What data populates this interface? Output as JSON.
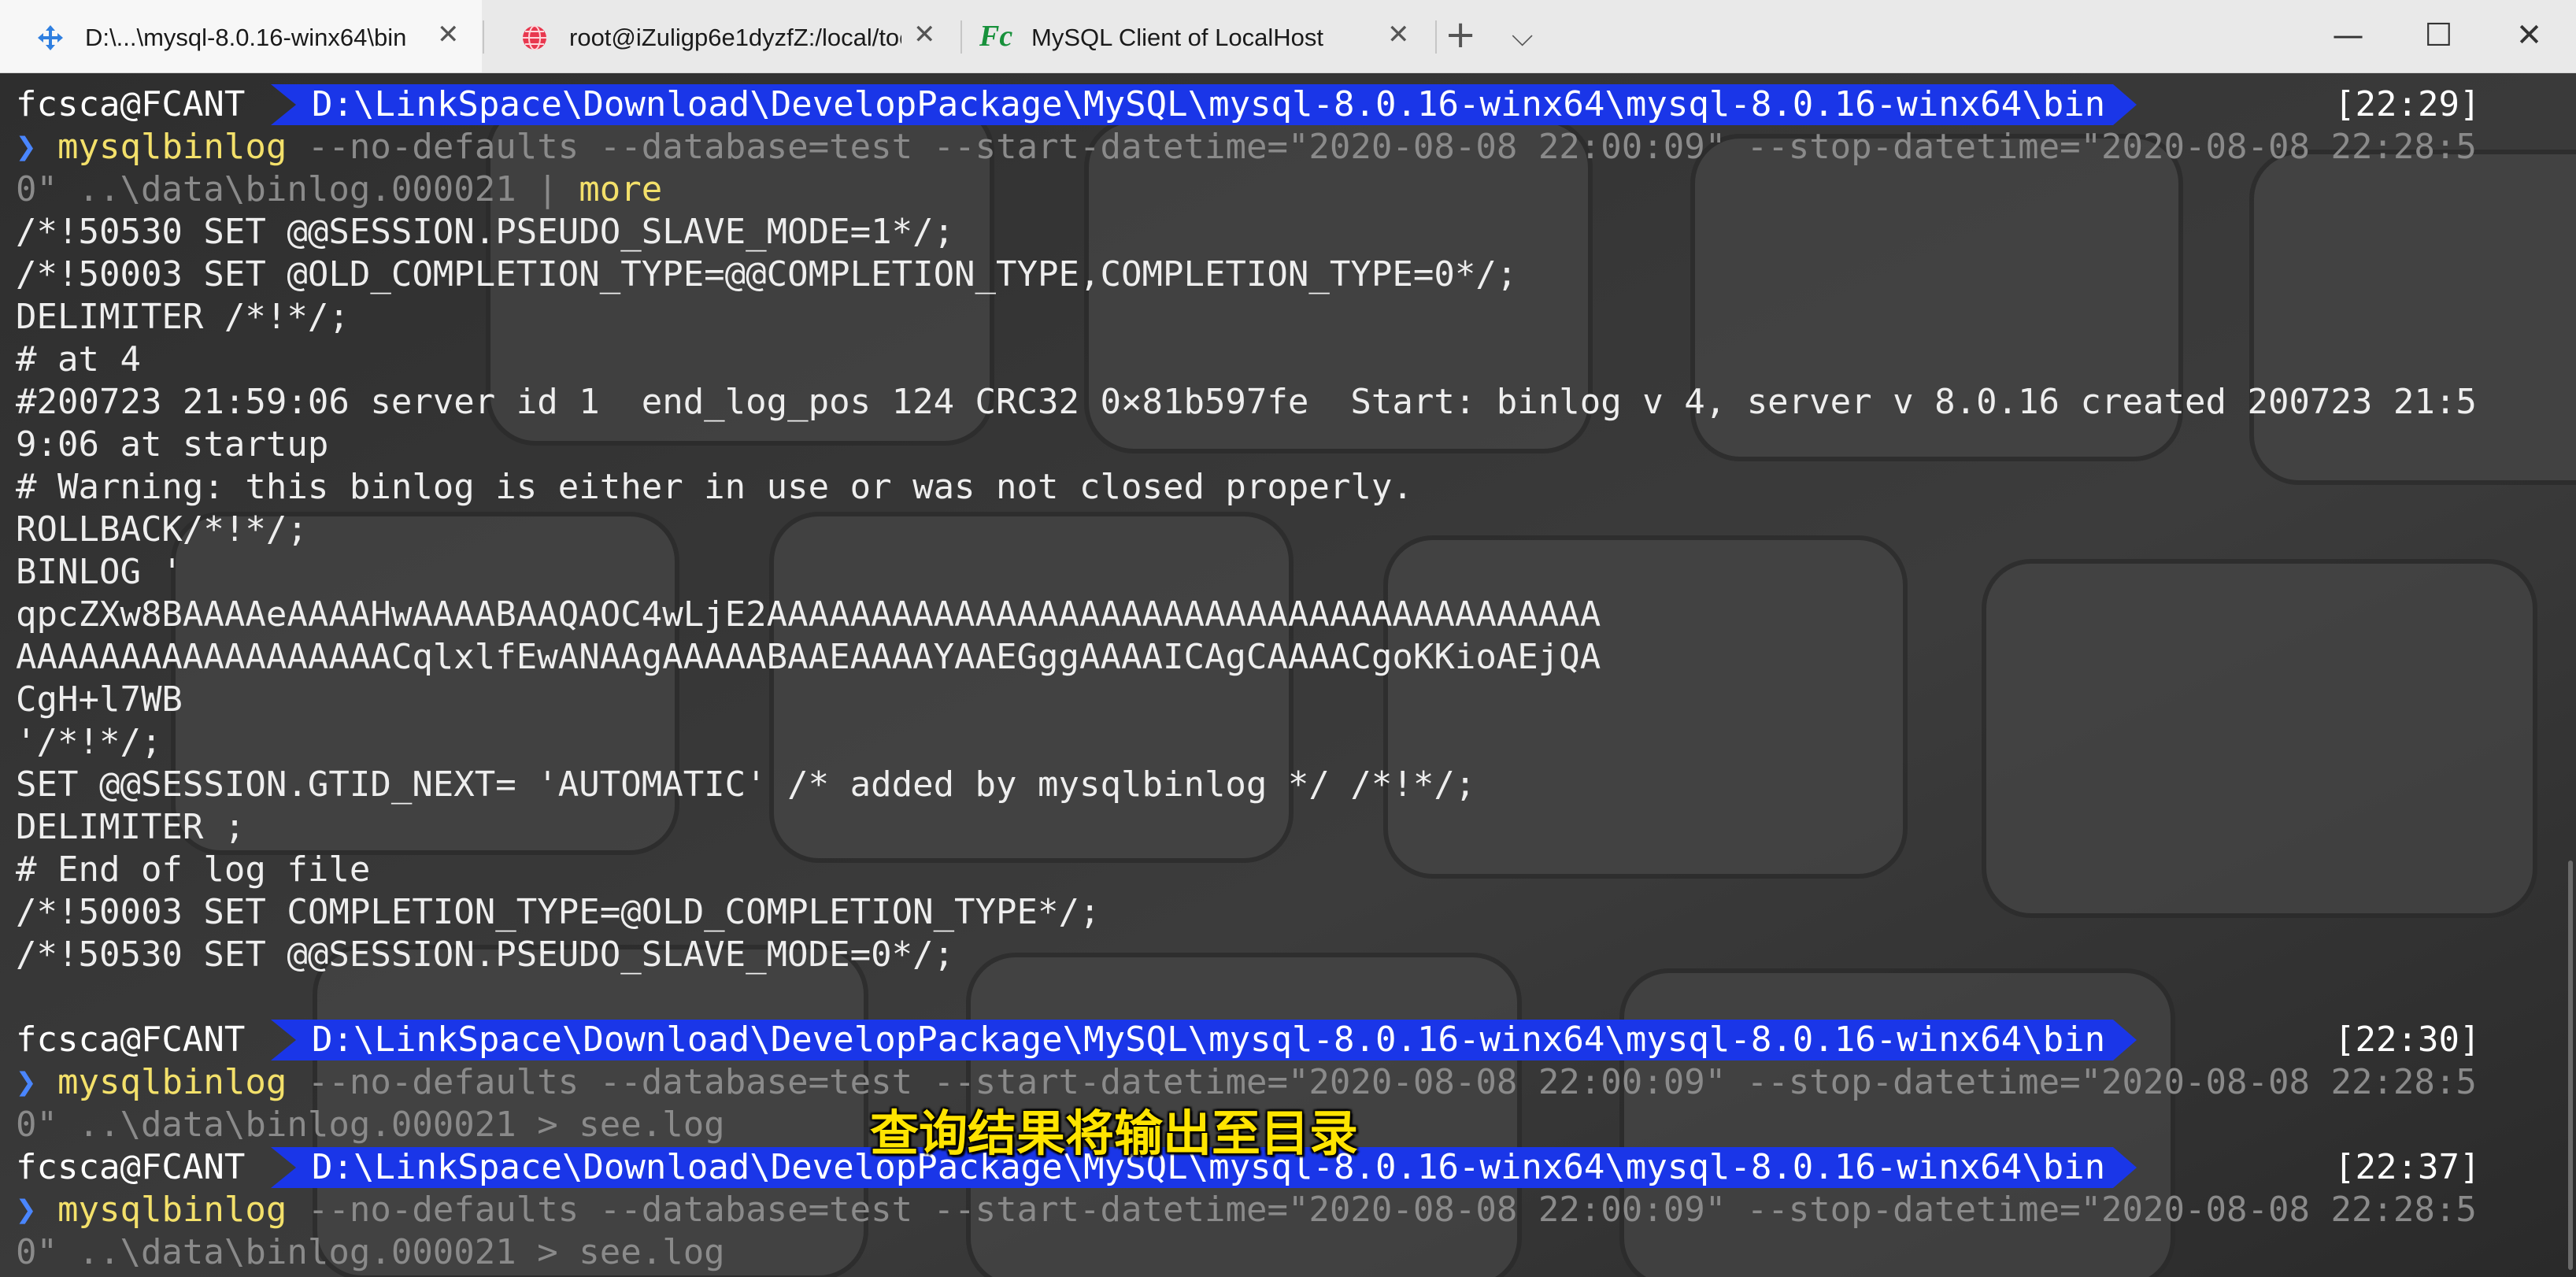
{
  "tabs": [
    {
      "label": "D:\\...\\mysql-8.0.16-winx64\\bin",
      "icon": "arrows-move-icon",
      "active": true
    },
    {
      "label": "root@iZuligp6e1dyzfZ:/local/too",
      "icon": "globe-icon",
      "active": false
    },
    {
      "label": "MySQL Client of LocalHost",
      "icon": "fc-icon",
      "icon_text": "Fc",
      "active": false
    }
  ],
  "tabbar": {
    "new_tab": "+",
    "dropdown": "⌵"
  },
  "window": {
    "minimize": "—",
    "maximize": "☐",
    "close": "✕"
  },
  "prompts": [
    {
      "user": "fcsca@FCANT",
      "path": "D:\\LinkSpace\\Download\\DevelopPackage\\MySQL\\mysql-8.0.16-winx64\\mysql-8.0.16-winx64\\bin",
      "time": "[22:29]"
    },
    {
      "user": "fcsca@FCANT",
      "path": "D:\\LinkSpace\\Download\\DevelopPackage\\MySQL\\mysql-8.0.16-winx64\\mysql-8.0.16-winx64\\bin",
      "time": "[22:30]"
    },
    {
      "user": "fcsca@FCANT",
      "path": "D:\\LinkSpace\\Download\\DevelopPackage\\MySQL\\mysql-8.0.16-winx64\\mysql-8.0.16-winx64\\bin",
      "time": "[22:37]"
    }
  ],
  "commands": {
    "arrow": "❯",
    "program": "mysqlbinlog",
    "args_line1": " --no-defaults --database=test --start-datetime=\"2020-08-08 22:00:09\" --stop-datetime=\"2020-08-08 22:28:5",
    "cmd1_line2": "0\" ..\\data\\binlog.000021 | ",
    "cmd1_more": "more",
    "cmd2_line2": "0\" ..\\data\\binlog.000021 > see.log",
    "cmd3_line2": "0\" ..\\data\\binlog.000021 > see.log"
  },
  "output": [
    "/*!50530 SET @@SESSION.PSEUDO_SLAVE_MODE=1*/;",
    "/*!50003 SET @OLD_COMPLETION_TYPE=@@COMPLETION_TYPE,COMPLETION_TYPE=0*/;",
    "DELIMITER /*!*/;",
    "# at 4",
    "#200723 21:59:06 server id 1  end_log_pos 124 CRC32 0×81b597fe  Start: binlog v 4, server v 8.0.16 created 200723 21:5",
    "9:06 at startup",
    "# Warning: this binlog is either in use or was not closed properly.",
    "ROLLBACK/*!*/;",
    "BINLOG '",
    "qpcZXw8BAAAAeAAAAHwAAAABAAQAOC4wLjE2AAAAAAAAAAAAAAAAAAAAAAAAAAAAAAAAAAAAAAAA",
    "AAAAAAAAAAAAAAAAAACqlxlfEwANAAgAAAAABAAEAAAAYAAEGggAAAAICAgCAAAACgoKKioAEjQA",
    "CgH+l7WB",
    "'/*!*/;",
    "SET @@SESSION.GTID_NEXT= 'AUTOMATIC' /* added by mysqlbinlog */ /*!*/;",
    "DELIMITER ;",
    "# End of log file",
    "/*!50003 SET COMPLETION_TYPE=@OLD_COMPLETION_TYPE*/;",
    "/*!50530 SET @@SESSION.PSEUDO_SLAVE_MODE=0*/;"
  ],
  "overlay_caption": "查询结果将输出至目录",
  "colors": {
    "prompt_bg": "#1a36e8",
    "command": "#f3e06a",
    "caption": "#ffe400",
    "arrow": "#4a86ff"
  }
}
